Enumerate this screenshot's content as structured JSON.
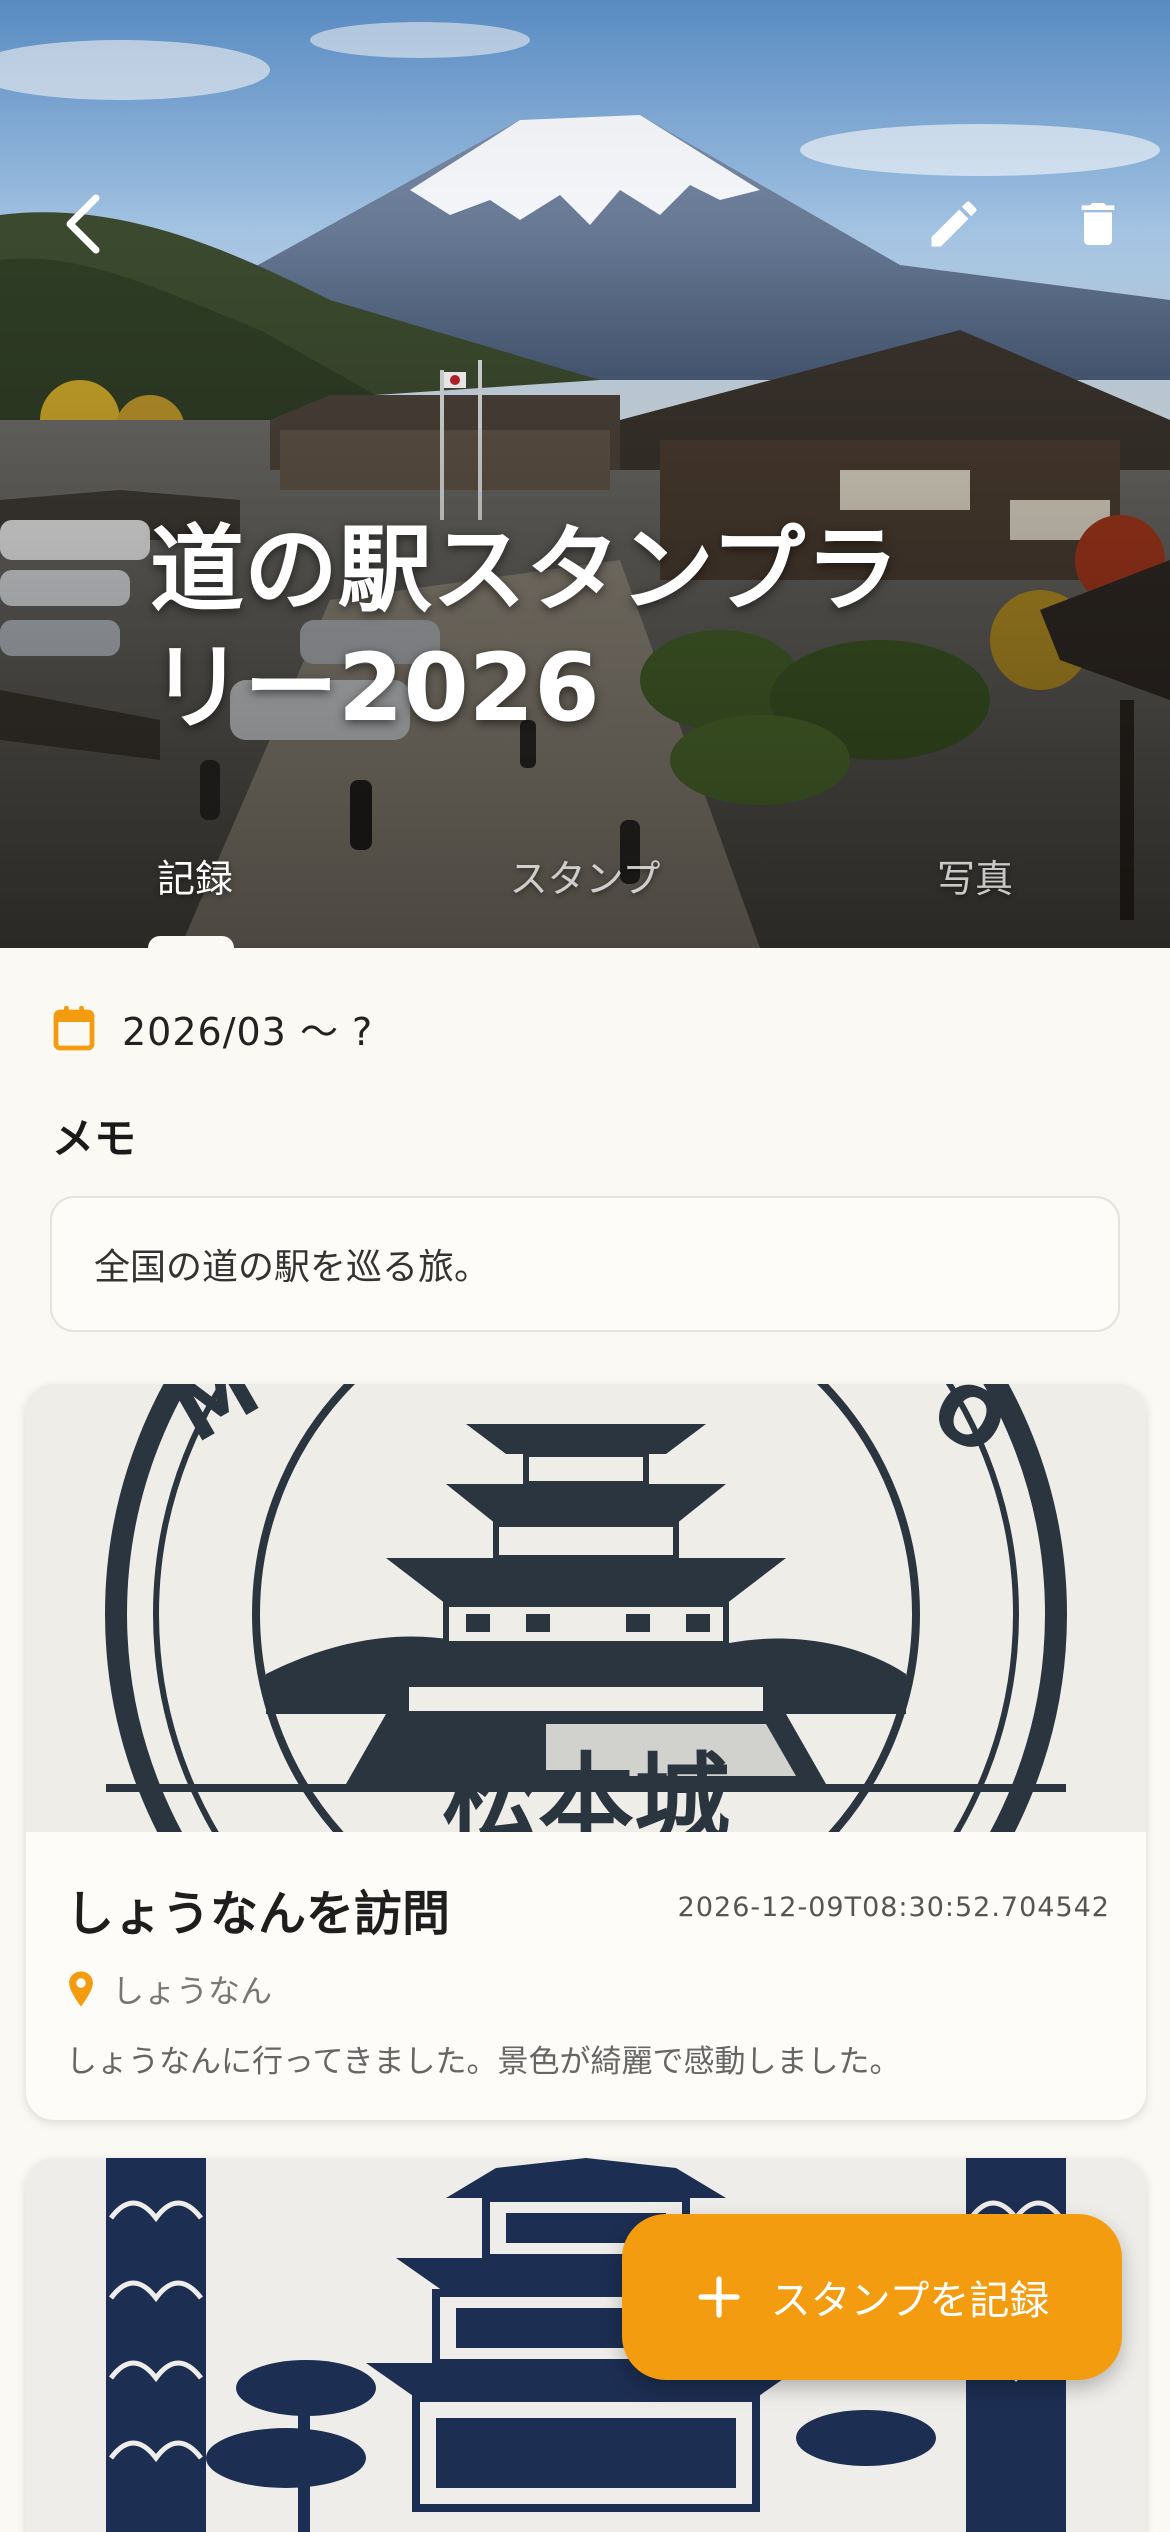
{
  "header": {
    "title": "道の駅スタンプラリー2026",
    "back_icon": "chevron-left-icon",
    "edit_icon": "pencil-icon",
    "delete_icon": "trash-icon"
  },
  "tabs": [
    {
      "label": "記録",
      "active": true
    },
    {
      "label": "スタンプ",
      "active": false
    },
    {
      "label": "写真",
      "active": false
    }
  ],
  "trip": {
    "date_range": "2026/03 〜 ?",
    "memo_heading": "メモ",
    "memo": "全国の道の駅を巡る旅。"
  },
  "records": [
    {
      "title": "しょうなんを訪問",
      "timestamp": "2026-12-09T08:30:52.704542",
      "location": "しょうなん",
      "description": "しょうなんに行ってきました。景色が綺麗で感動しました。",
      "stamp_label": "松本城"
    },
    {
      "title": "",
      "timestamp": "",
      "location": "",
      "description": "",
      "stamp_label": ""
    }
  ],
  "fab": {
    "label": "スタンプを記録",
    "icon": "plus-icon"
  },
  "colors": {
    "accent": "#f39c0f",
    "background": "#fbf9f3",
    "stamp_ink": "#2b3540",
    "stamp_ink_blue": "#1c2e52"
  }
}
